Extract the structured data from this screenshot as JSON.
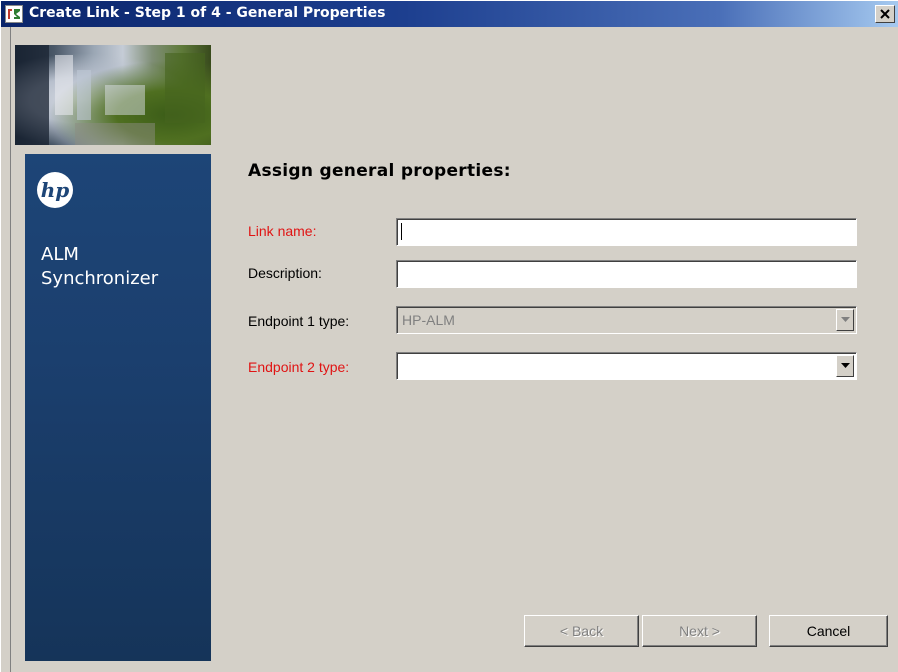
{
  "window": {
    "title": "Create Link - Step 1 of 4 - General Properties",
    "close_glyph": "✕"
  },
  "sidebar": {
    "logo_icon": "hp-logo-icon",
    "product_line1": "ALM",
    "product_line2": "Synchronizer",
    "accent_color": "#1d4577"
  },
  "form": {
    "heading": "Assign general properties:",
    "link_name": {
      "label": "Link name:",
      "value": "",
      "required": true
    },
    "description": {
      "label": "Description:",
      "value": ""
    },
    "endpoint1": {
      "label": "Endpoint 1 type:",
      "value": "HP-ALM",
      "disabled": true
    },
    "endpoint2": {
      "label": "Endpoint 2 type:",
      "value": "",
      "required": true
    },
    "required_color": "#e01414"
  },
  "buttons": {
    "back": "< Back",
    "next": "Next >",
    "cancel": "Cancel"
  }
}
